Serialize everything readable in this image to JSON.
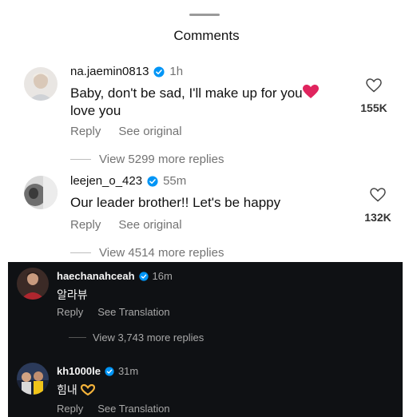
{
  "sheet": {
    "title": "Comments"
  },
  "comments": [
    {
      "username": "na.jaemin0813",
      "time": "1h",
      "text": "Baby, don't be sad, I'll make up for you",
      "text2": "love you",
      "reply": "Reply",
      "see_original": "See original",
      "likes": "155K",
      "view_more": "View 5299 more replies"
    },
    {
      "username": "leejen_o_423",
      "time": "55m",
      "text": "Our leader brother!! Let's be happy",
      "reply": "Reply",
      "see_original": "See original",
      "likes": "132K",
      "view_more": "View 4514 more replies"
    }
  ],
  "dark_comments": [
    {
      "username": "haechanahceah",
      "time": "16m",
      "text": "알라뷰",
      "reply": "Reply",
      "see_translation": "See Translation",
      "view_more": "View 3,743 more replies"
    },
    {
      "username": "kh1000le",
      "time": "31m",
      "text": "힘내",
      "reply": "Reply",
      "see_translation": "See Translation"
    }
  ],
  "colors": {
    "verified": "#0095f6",
    "heart": "#e0245e",
    "dark_bg": "#0f1114"
  },
  "icons": [
    "verified-badge-icon",
    "heart-outline-icon",
    "red-heart-emoji",
    "heart-hands-emoji"
  ]
}
